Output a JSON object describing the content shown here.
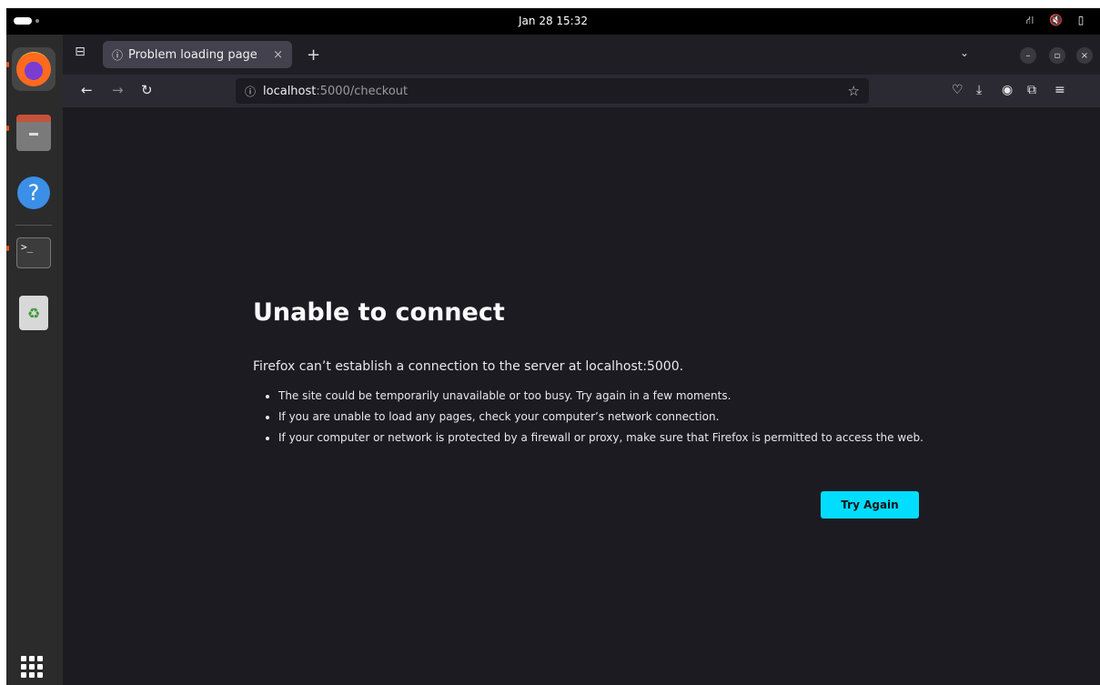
{
  "system": {
    "clock": "Jan 28  15:32",
    "tray": [
      "network-icon",
      "volume-muted-icon",
      "battery-icon"
    ]
  },
  "dock": {
    "apps": [
      "Firefox",
      "Files",
      "Help",
      "Terminal",
      "Trash"
    ],
    "terminal_prompt": ">_"
  },
  "browser": {
    "tab": {
      "title": "Problem loading page",
      "close": "×"
    },
    "new_tab": "+",
    "url": {
      "host": "localhost",
      "rest": ":5000/checkout"
    },
    "window_controls": {
      "minimize": "–",
      "maximize": "▫",
      "close": "×"
    }
  },
  "error_page": {
    "title": "Unable to connect",
    "description": "Firefox can’t establish a connection to the server at localhost:5000.",
    "bullets": [
      "The site could be temporarily unavailable or too busy. Try again in a few moments.",
      "If you are unable to load any pages, check your computer’s network connection.",
      "If your computer or network is protected by a firewall or proxy, make sure that Firefox is permitted to access the web."
    ],
    "button": "Try Again"
  },
  "colors": {
    "page_bg": "#1c1b22",
    "toolbar_bg": "#2b2a33",
    "accent_button": "#00ddff"
  }
}
